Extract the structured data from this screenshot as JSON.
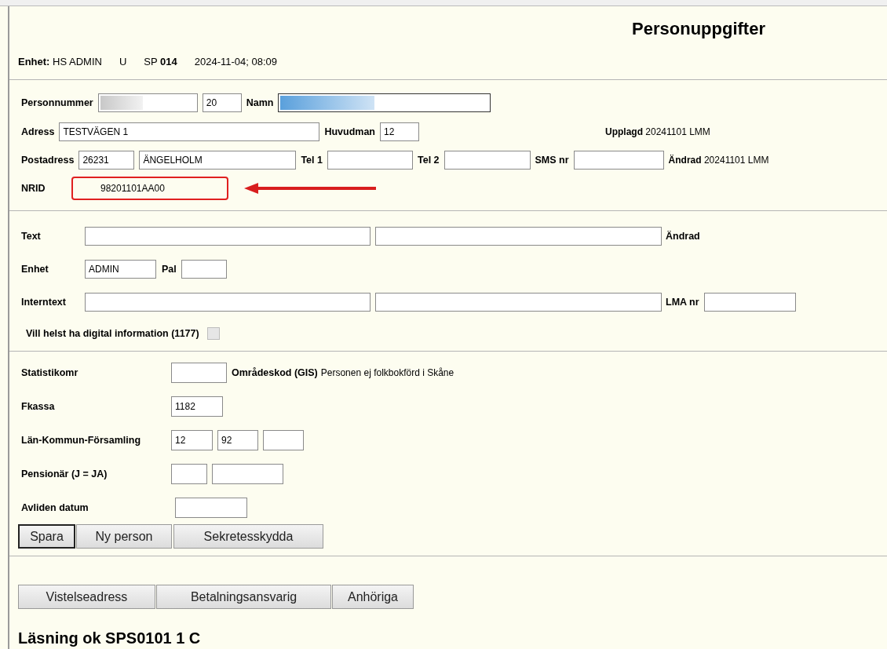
{
  "title": "Personuppgifter",
  "header": {
    "unit_label": "Enhet:",
    "unit_value": "HS ADMIN",
    "mode": "U",
    "sp_label": "SP",
    "sp_value": "014",
    "datetime": "2024-11-04; 08:09"
  },
  "person": {
    "personnummer": {
      "label": "Personnummer",
      "fields": [
        {
          "kind": "redacted"
        },
        {
          "kind": "input",
          "value": "20"
        }
      ]
    },
    "namn": {
      "label": "Namn",
      "field": {
        "kind": "redacted",
        "focused": true
      }
    },
    "adress": {
      "label": "Adress",
      "field": {
        "kind": "input",
        "value": "TESTVÄGEN 1"
      }
    },
    "huvudman": {
      "label": "Huvudman",
      "field": {
        "kind": "input",
        "value": "12"
      }
    },
    "upplagd": {
      "label": "Upplagd",
      "value": "20241101 LMM"
    },
    "postadress": {
      "label": "Postadress",
      "fields": [
        {
          "kind": "input",
          "value": "26231"
        },
        {
          "kind": "input",
          "value": "ÄNGELHOLM"
        }
      ]
    },
    "tel1": {
      "label": "Tel 1",
      "field": {
        "kind": "input"
      }
    },
    "tel2": {
      "label": "Tel 2",
      "field": {
        "kind": "input"
      }
    },
    "sms": {
      "label": "SMS nr",
      "field": {
        "kind": "input"
      }
    },
    "andrad": {
      "label": "Ändrad",
      "value": "20241101 LMM"
    },
    "nrid": {
      "label": "NRID",
      "value": "98201101AA00",
      "highlighted": true
    }
  },
  "notes": {
    "text": {
      "label": "Text",
      "fields": [
        {
          "kind": "input"
        },
        {
          "kind": "input"
        }
      ],
      "suffix": "Ändrad"
    },
    "enhet": {
      "label": "Enhet",
      "field": {
        "kind": "input",
        "value": "ADMIN"
      }
    },
    "pal": {
      "label": "Pal",
      "field": {
        "kind": "input"
      }
    },
    "internal": {
      "label": "Interntext",
      "fields": [
        {
          "kind": "input"
        },
        {
          "kind": "input"
        }
      ]
    },
    "lma": {
      "label": "LMA nr",
      "field": {
        "kind": "input"
      }
    },
    "digital": {
      "label": "Vill helst ha digital information (1177)",
      "checked": false,
      "disabled": true
    }
  },
  "stats": [
    {
      "label": "Statistikomr",
      "fields": [
        {
          "kind": "input"
        }
      ],
      "after_label": "Områdeskod (GIS)",
      "after_text": "Personen ej folkbokförd i Skåne"
    },
    {
      "label": "Fkassa",
      "fields": [
        {
          "kind": "input",
          "value": "1182"
        }
      ]
    },
    {
      "label": "Län-Kommun-Församling",
      "fields": [
        {
          "kind": "input",
          "value": "12"
        },
        {
          "kind": "input",
          "value": "92"
        },
        {
          "kind": "input"
        }
      ]
    },
    {
      "label": "Pensionär (J = JA)",
      "fields": [
        {
          "kind": "input"
        },
        {
          "kind": "input"
        }
      ]
    },
    {
      "label": "Avliden datum",
      "fields": [
        {
          "kind": "input"
        }
      ]
    }
  ],
  "actions": [
    {
      "label": "Spara",
      "default": true
    },
    {
      "label": "Ny person",
      "default": false
    },
    {
      "label": "Sekretesskydda",
      "default": false
    }
  ],
  "links": [
    {
      "label": "Vistelseadress"
    },
    {
      "label": "Betalningsansvarig"
    },
    {
      "label": "Anhöriga"
    }
  ],
  "status": "Läsning ok SPS0101 1 C"
}
